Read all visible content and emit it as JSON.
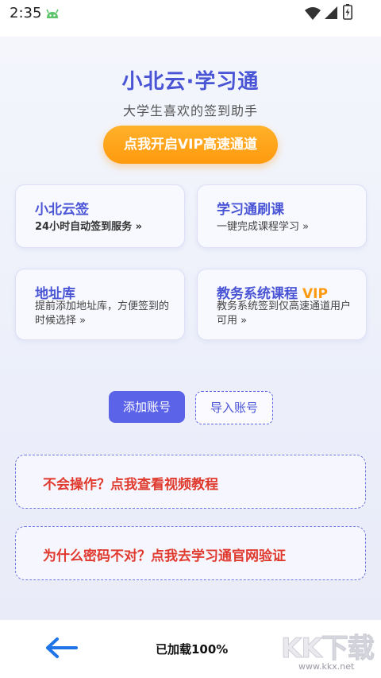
{
  "status_bar": {
    "time": "2:35",
    "icons": [
      "android-icon",
      "wifi-icon",
      "signal-icon",
      "battery-icon"
    ]
  },
  "header": {
    "title": "小北云·学习通",
    "subtitle": "大学生喜欢的签到助手",
    "vip_button": "点我开启VIP高速通道"
  },
  "cards": [
    {
      "title": "小北云签",
      "desc": "24小时自动签到服务 »"
    },
    {
      "title": "学习通刷课",
      "desc": "一键完成课程学习 »"
    },
    {
      "title": "地址库",
      "desc": "提前添加地址库，方便签到的时候选择 »"
    },
    {
      "title": "教务系统课程",
      "tag": "VIP",
      "desc": "教务系统签到仅高速通道用户可用 »"
    }
  ],
  "account": {
    "add_label": "添加账号",
    "import_label": "导入账号"
  },
  "links": {
    "tutorial": "不会操作？点我查看视频教程",
    "verify": "为什么密码不对？点我去学习通官网验证"
  },
  "bottom": {
    "load_status": "已加载100%",
    "watermark": "KK下载",
    "watermark_url": "www.kkx.net"
  },
  "colors": {
    "accent": "#4a55d6",
    "vip_orange": "#ff9a0e",
    "warning_red": "#e03a2f",
    "button_blue": "#5b63e8"
  }
}
